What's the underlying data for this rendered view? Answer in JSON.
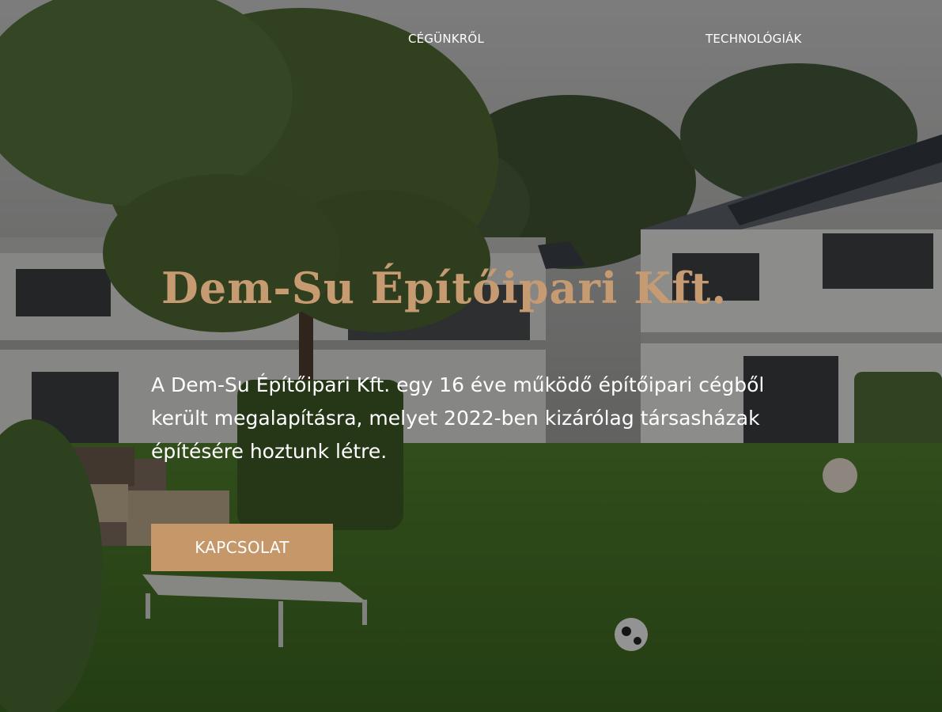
{
  "nav": {
    "items": [
      {
        "label": "CÉGÜNKRŐL"
      },
      {
        "label": "TECHNOLÓGIÁK"
      }
    ]
  },
  "hero": {
    "title": "Dem-Su Építőipari Kft.",
    "description": "A Dem-Su Építőipari Kft. egy 16 éve működő építőipari cégből került megalapításra, melyet 2022-ben kizárólag társasházak építésére hoztunk létre.",
    "cta_label": "KAPCSOLAT"
  },
  "colors": {
    "accent": "#c79b72",
    "button": "#c59769",
    "text": "#ffffff"
  }
}
